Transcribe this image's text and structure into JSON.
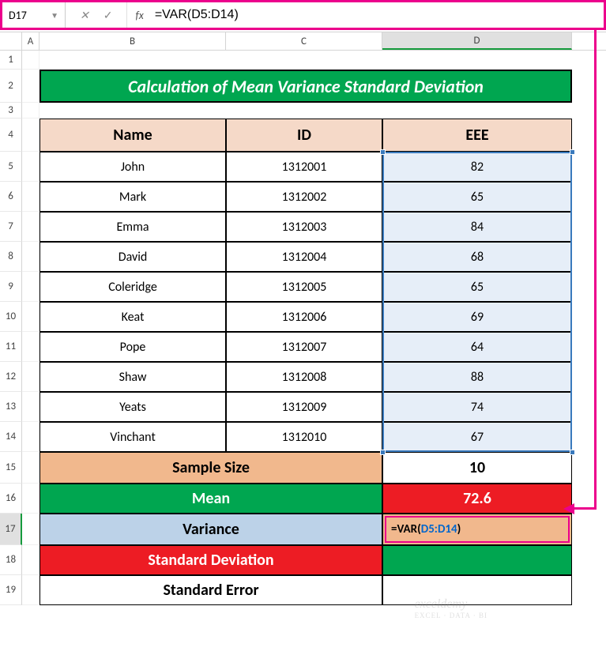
{
  "name_box": "D17",
  "formula_text": "=VAR(D5:D14)",
  "fx_label": "fx",
  "columns": [
    "A",
    "B",
    "C",
    "D"
  ],
  "row_numbers": [
    "1",
    "2",
    "3",
    "4",
    "5",
    "6",
    "7",
    "8",
    "9",
    "10",
    "11",
    "12",
    "13",
    "14",
    "15",
    "16",
    "17",
    "18",
    "19"
  ],
  "title": "Calculation of Mean Variance Standard Deviation",
  "headers": {
    "name": "Name",
    "id": "ID",
    "eee": "EEE"
  },
  "rows": [
    {
      "name": "John",
      "id": "1312001",
      "eee": "82"
    },
    {
      "name": "Mark",
      "id": "1312002",
      "eee": "65"
    },
    {
      "name": "Emma",
      "id": "1312003",
      "eee": "84"
    },
    {
      "name": "David",
      "id": "1312004",
      "eee": "68"
    },
    {
      "name": "Coleridge",
      "id": "1312005",
      "eee": "65"
    },
    {
      "name": "Keat",
      "id": "1312006",
      "eee": "69"
    },
    {
      "name": "Pope",
      "id": "1312007",
      "eee": "64"
    },
    {
      "name": "Shaw",
      "id": "1312008",
      "eee": "88"
    },
    {
      "name": "Yeats",
      "id": "1312009",
      "eee": "74"
    },
    {
      "name": "Vinchant",
      "id": "1312010",
      "eee": "67"
    }
  ],
  "summary": {
    "sample_size_label": "Sample Size",
    "sample_size_value": "10",
    "mean_label": "Mean",
    "mean_value": "72.6",
    "variance_label": "Variance",
    "variance_prefix": "=VAR(",
    "variance_ref": "D5:D14",
    "variance_suffix": ")",
    "sd_label": "Standard Deviation",
    "se_label": "Standard Error"
  },
  "watermark": {
    "main": "exceldemy",
    "sub": "EXCEL · DATA · BI"
  }
}
